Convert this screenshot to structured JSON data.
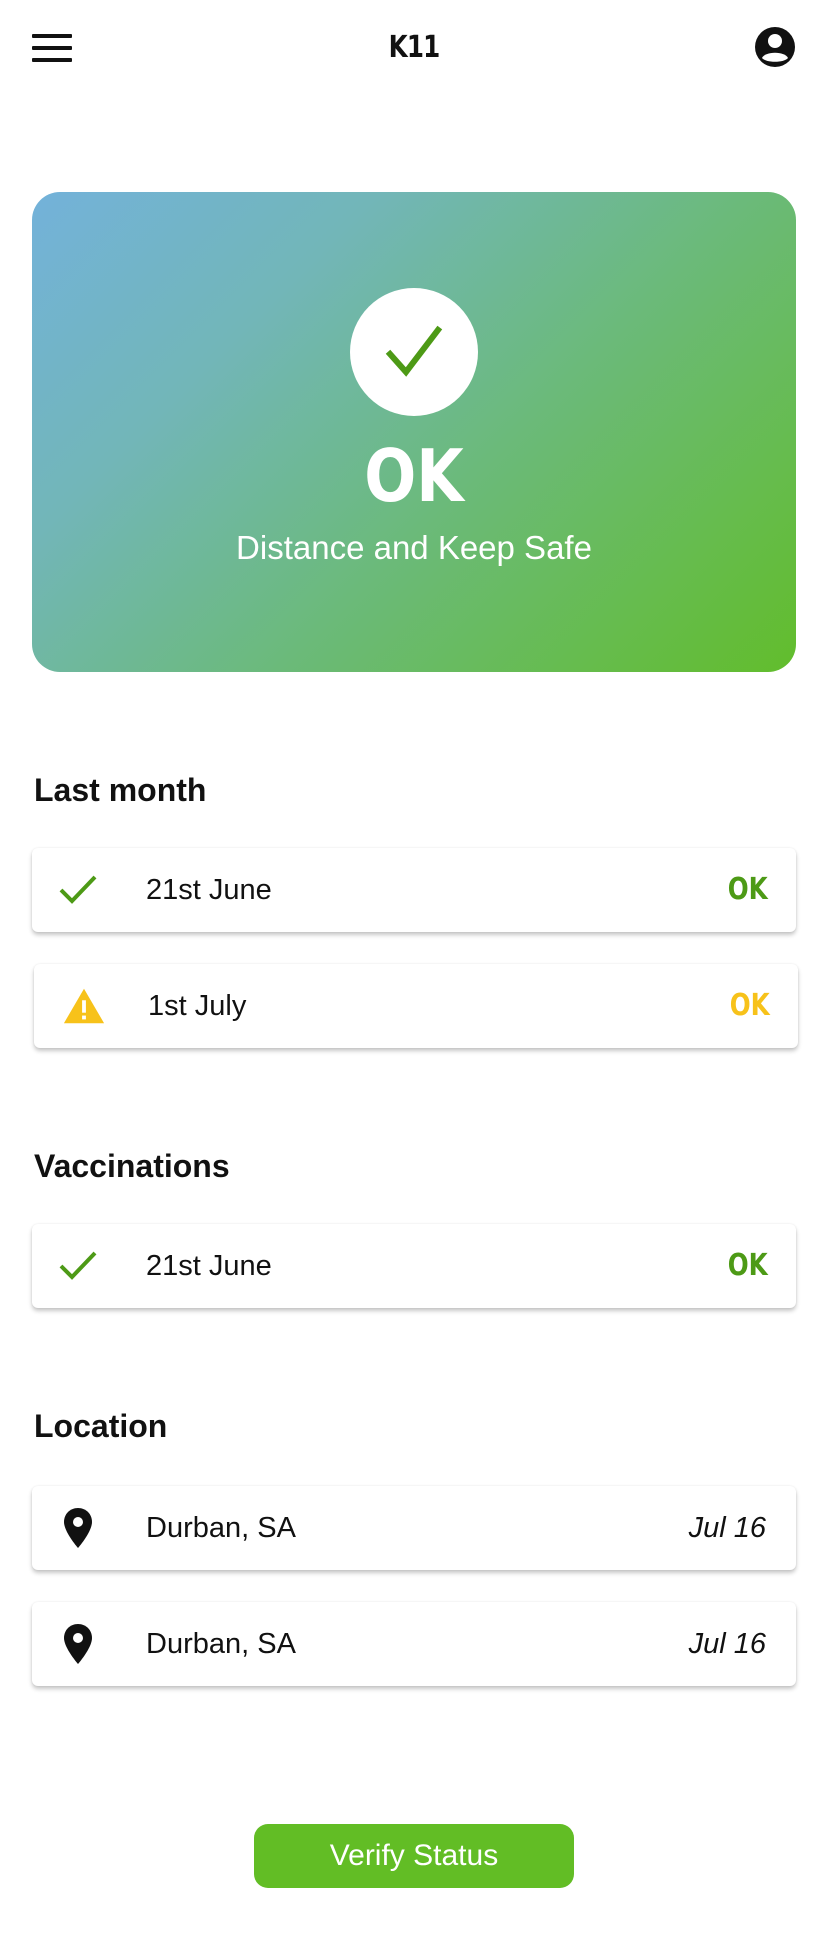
{
  "header": {
    "title": "K11",
    "menu_icon": "hamburger-menu-icon",
    "profile_icon": "account-circle-icon"
  },
  "status_card": {
    "status": "OK",
    "message": "Distance and Keep Safe",
    "icon": "check-icon",
    "gradient_colors": [
      "#73b2da",
      "#62bd2c"
    ]
  },
  "last_month": {
    "title": "Last month",
    "items": [
      {
        "icon": "check-icon",
        "date": "21st June",
        "status": "OK",
        "status_color": "#4d9a16"
      },
      {
        "icon": "warning-icon",
        "date": "1st July",
        "status": "OK",
        "status_color": "#f7c21a"
      }
    ]
  },
  "vaccinations": {
    "title": "Vaccinations",
    "items": [
      {
        "icon": "check-icon",
        "date": "21st June",
        "status": "OK",
        "status_color": "#4d9a16"
      }
    ]
  },
  "location": {
    "title": "Location",
    "items": [
      {
        "icon": "map-pin-icon",
        "place": "Durban, SA",
        "date": "Jul 16"
      },
      {
        "icon": "map-pin-icon",
        "place": "Durban, SA",
        "date": "Jul 16"
      }
    ]
  },
  "verify_button": {
    "label": "Verify Status",
    "color": "#62bd25"
  }
}
